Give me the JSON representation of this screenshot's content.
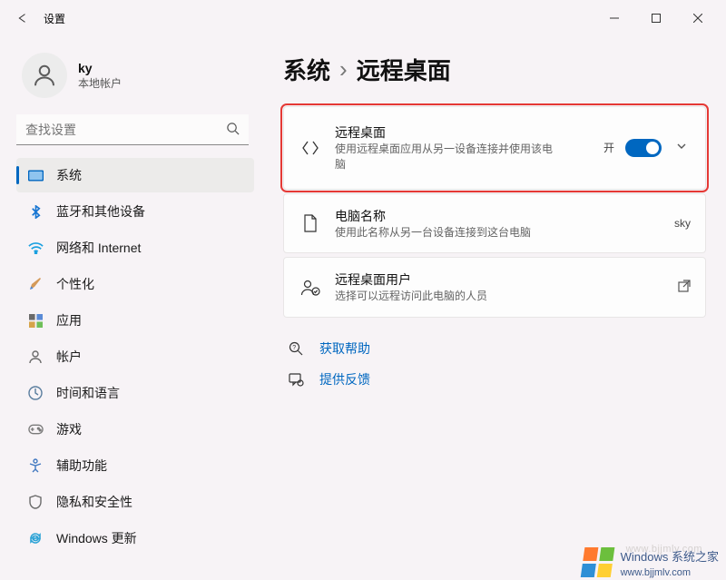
{
  "titlebar": {
    "app_title": "设置"
  },
  "user": {
    "name": "ky",
    "subtitle": "本地帐户"
  },
  "search": {
    "placeholder": "查找设置"
  },
  "nav": {
    "items": [
      {
        "label": "系统",
        "icon": "system-icon",
        "selected": true
      },
      {
        "label": "蓝牙和其他设备",
        "icon": "bluetooth-icon"
      },
      {
        "label": "网络和 Internet",
        "icon": "network-icon"
      },
      {
        "label": "个性化",
        "icon": "personalize-icon"
      },
      {
        "label": "应用",
        "icon": "apps-icon"
      },
      {
        "label": "帐户",
        "icon": "accounts-icon"
      },
      {
        "label": "时间和语言",
        "icon": "time-lang-icon"
      },
      {
        "label": "游戏",
        "icon": "gaming-icon"
      },
      {
        "label": "辅助功能",
        "icon": "accessibility-icon"
      },
      {
        "label": "隐私和安全性",
        "icon": "privacy-icon"
      },
      {
        "label": "Windows 更新",
        "icon": "update-icon"
      }
    ]
  },
  "breadcrumb": {
    "root": "系统",
    "leaf": "远程桌面"
  },
  "cards": {
    "remote": {
      "title": "远程桌面",
      "sub": "使用远程桌面应用从另一设备连接并使用该电脑",
      "state_label": "开",
      "state_on": true
    },
    "pcname": {
      "title": "电脑名称",
      "sub": "使用此名称从另一台设备连接到这台电脑",
      "value": "sky"
    },
    "users": {
      "title": "远程桌面用户",
      "sub": "选择可以远程访问此电脑的人员"
    }
  },
  "links": {
    "help": "获取帮助",
    "feedback": "提供反馈"
  },
  "badge": {
    "brand": "Windows",
    "suffix": "系统之家",
    "url": "www.bjjmlv.com"
  }
}
